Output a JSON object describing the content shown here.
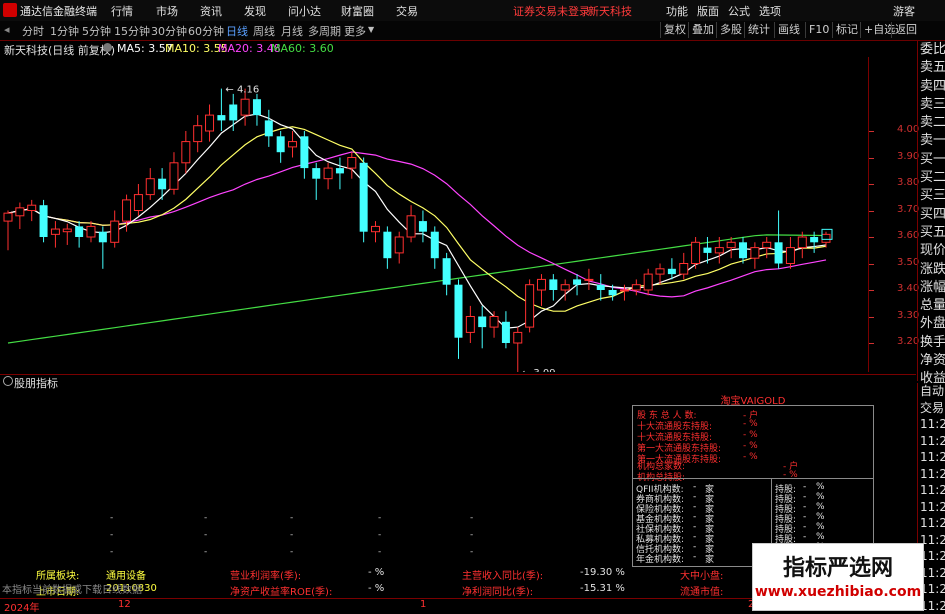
{
  "app": {
    "name": "通达信金融终端"
  },
  "top_menu": [
    "行情",
    "市场",
    "资讯",
    "发现",
    "问小达",
    "财富圈",
    "交易"
  ],
  "account_status": "证券交易未登录",
  "stock_name_top": "新天科技",
  "top_right": [
    "功能",
    "版面",
    "公式",
    "选项"
  ],
  "guest": "游客",
  "periods": [
    "分时",
    "1分钟",
    "5分钟",
    "15分钟",
    "30分钟",
    "60分钟",
    "日线",
    "周线",
    "月线",
    "多周期",
    "更多"
  ],
  "active_period": "日线",
  "toolbar_right": [
    "复权",
    "叠加",
    "多股",
    "统计",
    "画线",
    "F10",
    "标记",
    "+自选",
    "返回"
  ],
  "ma": {
    "title": "新天科技(日线 前复权)",
    "ma5": "MA5: 3.57",
    "ma10": "MA10: 3.55",
    "ma20": "MA20: 3.48",
    "ma60": "MA60: 3.60",
    "colors": {
      "ma5": "#ffffff",
      "ma10": "#ffff66",
      "ma20": "#ff44ff",
      "ma60": "#44dd44"
    }
  },
  "chart_data": {
    "type": "candlestick",
    "y_ticks": [
      "4.00",
      "3.90",
      "3.80",
      "3.70",
      "3.60",
      "3.50",
      "3.40",
      "3.30",
      "3.20"
    ],
    "high_label": "4.16",
    "low_label": "3.09",
    "current_price": "3.61",
    "colors": {
      "up": "#ff3030",
      "down": "#44ffff",
      "ma60": "#44dd44"
    }
  },
  "indicator": {
    "title": "股朋指标",
    "lock_icon": "lock-icon"
  },
  "side_quote": [
    "委比",
    "卖五",
    "卖四",
    "卖三",
    "卖二",
    "卖一",
    "买一",
    "买二",
    "买三",
    "买四",
    "买五",
    "现价",
    "涨跌",
    "涨幅",
    "总量",
    "外盘",
    "换手",
    "净资",
    "收益"
  ],
  "side_trade": [
    "自动",
    "交易",
    "11:29",
    "11:29",
    "11:29",
    "11:29",
    "11:29",
    "11:29",
    "11:29",
    "11:29",
    "11:29",
    "11:29",
    "11:29",
    "11:29"
  ],
  "panel": {
    "header": "淘宝VAIGOLD",
    "rows": [
      {
        "label": "股 东 总 人 数:",
        "value": "- 户"
      },
      {
        "label": "十大流通股东持股:",
        "value": "- %"
      },
      {
        "label": "十大流通股东持股:",
        "value": "- %"
      },
      {
        "label": "第一大流通股东持股:",
        "value": "- %"
      },
      {
        "label": "第一大流通股东持股:",
        "value": "- %"
      },
      {
        "label": "机构总家数:",
        "value": "- 户"
      },
      {
        "label": "机构总持股:",
        "value": "- %"
      }
    ],
    "inst_rows": [
      {
        "label": "QFII机构数:",
        "unit": "家",
        "hold": "持股:",
        "pct": "%"
      },
      {
        "label": "券商机构数:",
        "unit": "家",
        "hold": "持股:",
        "pct": "%"
      },
      {
        "label": "保险机构数:",
        "unit": "家",
        "hold": "持股:",
        "pct": "%"
      },
      {
        "label": "基金机构数:",
        "unit": "家",
        "hold": "持股:",
        "pct": "%"
      },
      {
        "label": "社保机构数:",
        "unit": "家",
        "hold": "持股:",
        "pct": "%"
      },
      {
        "label": "私募机构数:",
        "unit": "家",
        "hold": "持股:",
        "pct": "%"
      },
      {
        "label": "信托机构数:",
        "unit": "家",
        "hold": "持股:",
        "pct": "%"
      },
      {
        "label": "年金机构数:",
        "unit": "家",
        "hold": "持股:",
        "pct": "%"
      }
    ]
  },
  "bottom_info": {
    "industry_label": "所属板块:",
    "industry": "通用设备",
    "listing_label": "上市日期:",
    "listing_date": "20110830",
    "profit_label": "营业利润率(季):",
    "profit": "- %",
    "roe_label": "净资产收益率ROE(季):",
    "roe": "- %",
    "rev_label": "主营收入同比(季):",
    "rev": "-19.30 %",
    "np_label": "净利润同比(季):",
    "np": "-15.31 %",
    "size_label": "大中小盘:",
    "mcap_label": "流通市值:"
  },
  "status_note": "本指标当前数据或下载日线数据",
  "timeline": {
    "year": "2024年",
    "m1": "12",
    "m2": "1",
    "m3": "2"
  },
  "watermark": {
    "title": "指标严选网",
    "url": "www.xuezhibiao.com"
  }
}
